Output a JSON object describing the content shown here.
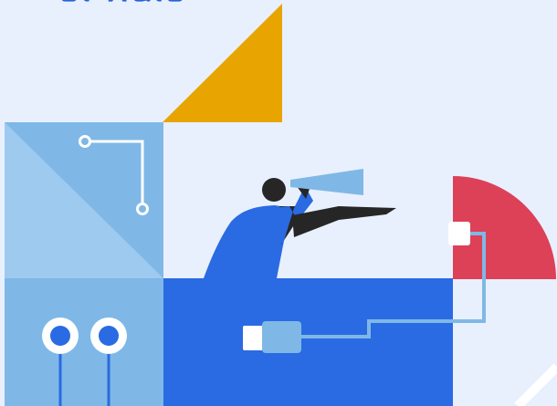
{
  "header": {
    "title_fragment": "ᥱᥣ ᥕᥲᥣᥱ"
  },
  "palette": {
    "background": "#e8f0fd",
    "primary_blue": "#2a6ae3",
    "light_blue": "#7fb8e6",
    "pale_blue": "#9ecaf0",
    "amber": "#e8a400",
    "red": "#dc4158",
    "dark": "#262626",
    "white": "#ffffff"
  },
  "illustration": {
    "subject": "person-with-telescope",
    "icons": [
      "telescope-icon",
      "usb-plug-icon",
      "circuit-trace-icon",
      "connector-node-icon"
    ]
  }
}
